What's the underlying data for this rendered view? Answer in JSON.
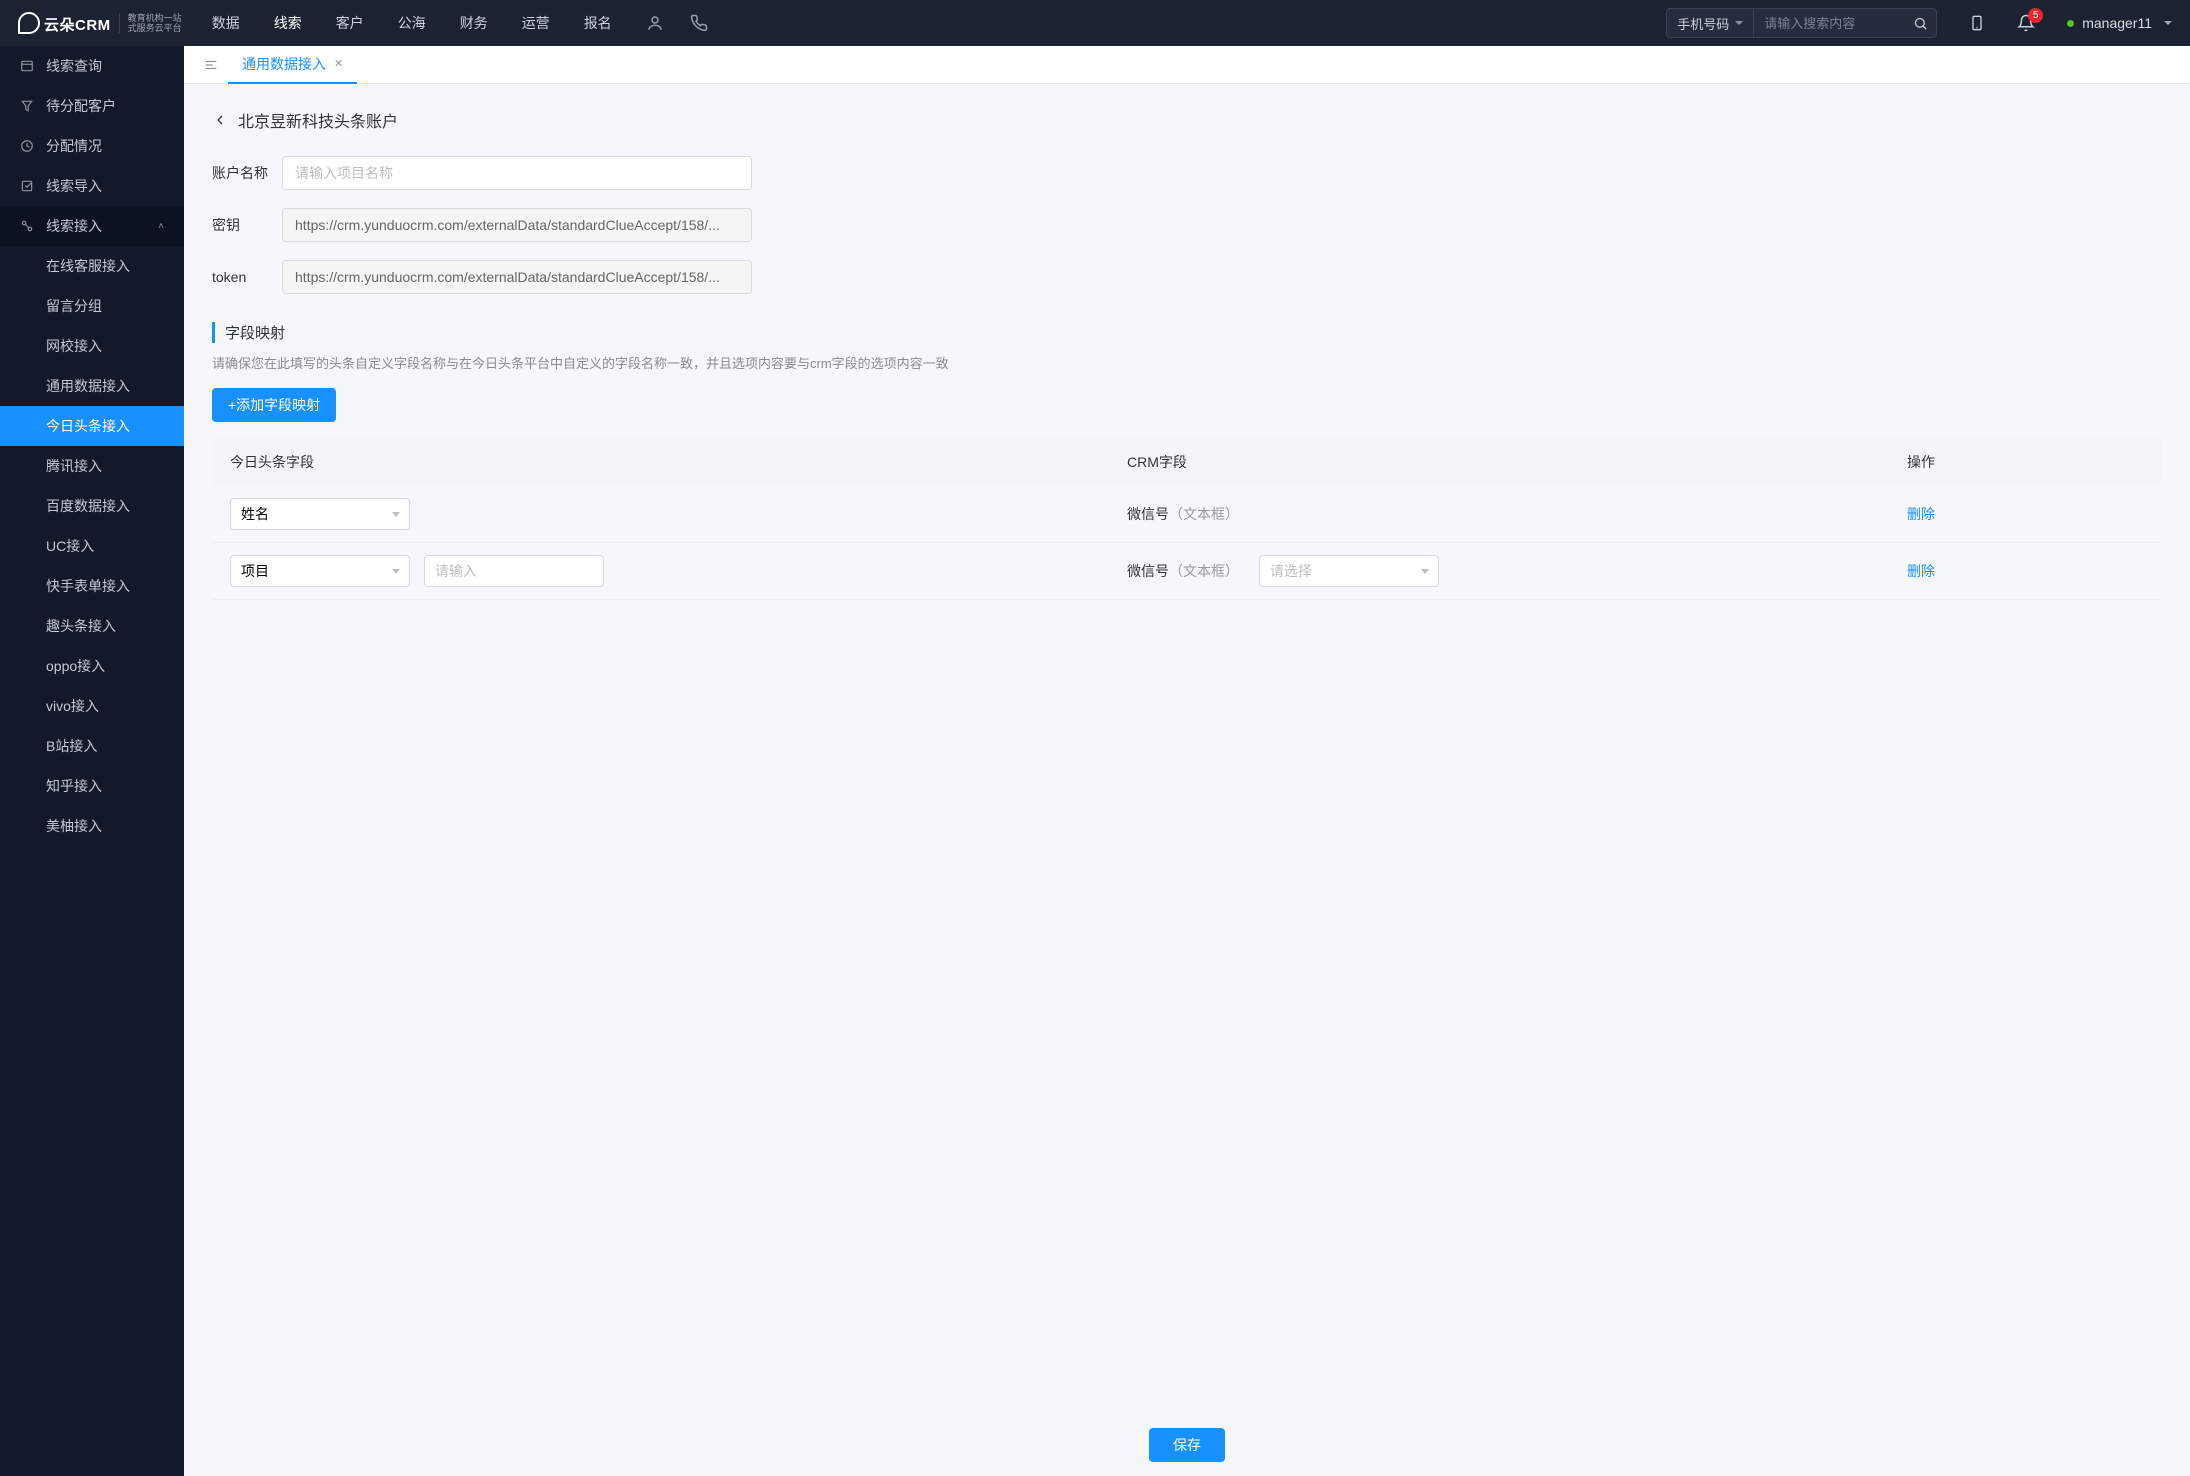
{
  "logo": {
    "name": "云朵CRM",
    "sub_url": "www.yunduocrm.com",
    "subtitle1": "教育机构一站",
    "subtitle2": "式服务云平台"
  },
  "topnav": [
    "数据",
    "线索",
    "客户",
    "公海",
    "财务",
    "运营",
    "报名"
  ],
  "topnav_active": 1,
  "search": {
    "type": "手机号码",
    "placeholder": "请输入搜索内容"
  },
  "notifications": {
    "count": 5
  },
  "user": {
    "name": "manager11"
  },
  "sidebar": {
    "items": [
      {
        "label": "线索查询"
      },
      {
        "label": "待分配客户"
      },
      {
        "label": "分配情况"
      },
      {
        "label": "线索导入"
      },
      {
        "label": "线索接入",
        "expanded": true,
        "children": [
          "在线客服接入",
          "留言分组",
          "网校接入",
          "通用数据接入",
          "今日头条接入",
          "腾讯接入",
          "百度数据接入",
          "UC接入",
          "快手表单接入",
          "趣头条接入",
          "oppo接入",
          "vivo接入",
          "B站接入",
          "知乎接入",
          "美柚接入"
        ],
        "active_child": 4
      }
    ]
  },
  "tabs": [
    {
      "label": "通用数据接入",
      "closable": true
    }
  ],
  "page": {
    "title": "北京昱新科技头条账户",
    "form": {
      "account_label": "账户名称",
      "account_placeholder": "请输入项目名称",
      "secret_label": "密钥",
      "secret_value": "https://crm.yunduocrm.com/externalData/standardClueAccept/158/...",
      "token_label": "token",
      "token_value": "https://crm.yunduocrm.com/externalData/standardClueAccept/158/..."
    },
    "section": {
      "title": "字段映射",
      "hint": "请确保您在此填写的头条自定义字段名称与在今日头条平台中自定义的字段名称一致，并且选项内容要与crm字段的选项内容一致",
      "add_btn": "+添加字段映射"
    },
    "table": {
      "headers": [
        "今日头条字段",
        "CRM字段",
        "操作"
      ],
      "rows": [
        {
          "field_select": "姓名",
          "crm_label": "微信号",
          "crm_type": "（文本框）",
          "action": "删除"
        },
        {
          "field_select": "项目",
          "extra_input_placeholder": "请输入",
          "crm_label": "微信号",
          "crm_type": "（文本框）",
          "crm_select_placeholder": "请选择",
          "action": "删除"
        }
      ]
    },
    "save": "保存"
  }
}
